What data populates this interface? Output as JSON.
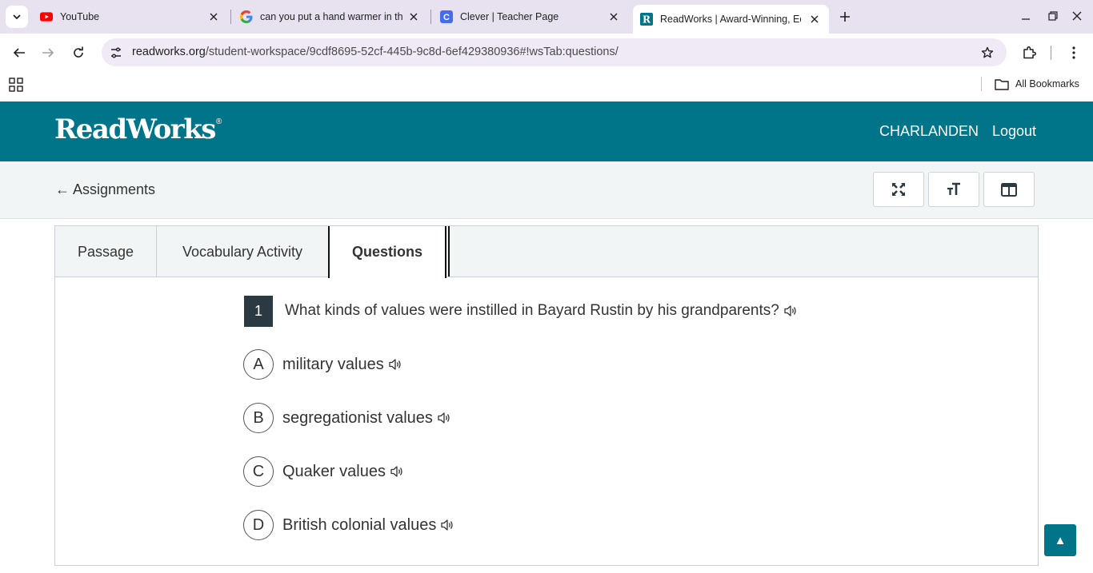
{
  "browser": {
    "tabs": [
      {
        "title": "YouTube",
        "favicon": "youtube-icon"
      },
      {
        "title": "can you put a hand warmer in th",
        "favicon": "google-icon"
      },
      {
        "title": "Clever | Teacher Page",
        "favicon": "clever-icon"
      },
      {
        "title": "ReadWorks | Award-Winning, Ed",
        "favicon": "readworks-icon",
        "active": true
      }
    ],
    "url_host": "readworks.org",
    "url_path": "/student-workspace/9cdf8695-52cf-445b-9c8d-6ef429380936#!wsTab:questions/",
    "bookmarks_label": "All Bookmarks"
  },
  "header": {
    "logo": "ReadWorks",
    "logo_mark": "®",
    "username": "CHARLANDEN",
    "logout": "Logout",
    "brand_color": "#007489"
  },
  "subnav": {
    "back_label": "← Assignments",
    "tools": [
      "fullscreen-icon",
      "text-size-icon",
      "split-view-icon"
    ]
  },
  "tabs": {
    "passage": "Passage",
    "vocab": "Vocabulary Activity",
    "questions": "Questions",
    "active": "Questions"
  },
  "question": {
    "number": "1",
    "text": "What kinds of values were instilled in Bayard Rustin by his grandparents?",
    "choices": [
      {
        "letter": "A",
        "text": "military values"
      },
      {
        "letter": "B",
        "text": "segregationist values"
      },
      {
        "letter": "C",
        "text": "Quaker values"
      },
      {
        "letter": "D",
        "text": "British colonial values"
      }
    ]
  },
  "scroll_top_label": "▲"
}
